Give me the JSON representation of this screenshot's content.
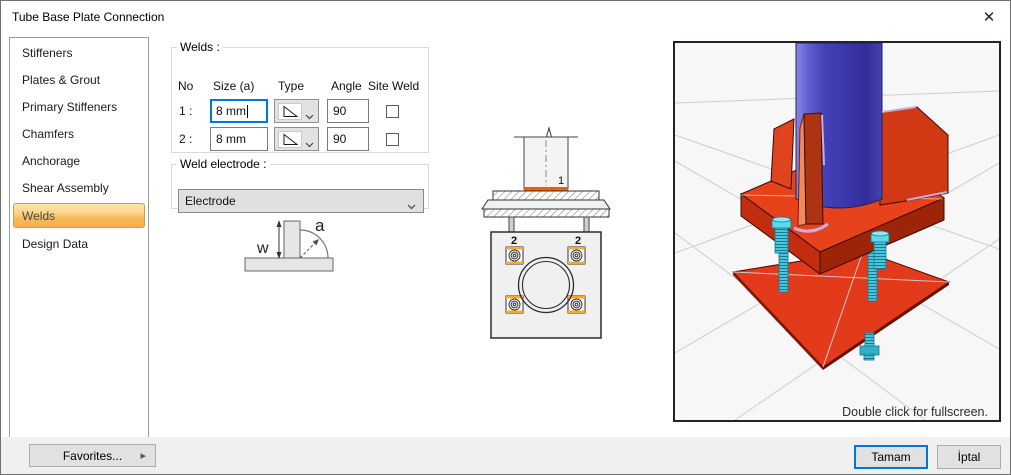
{
  "window": {
    "title": "Tube Base Plate Connection",
    "close_glyph": "✕"
  },
  "sidebar": {
    "items": [
      {
        "label": "Stiffeners",
        "selected": false
      },
      {
        "label": "Plates & Grout",
        "selected": false
      },
      {
        "label": "Primary Stiffeners",
        "selected": false
      },
      {
        "label": "Chamfers",
        "selected": false
      },
      {
        "label": "Anchorage",
        "selected": false
      },
      {
        "label": "Shear Assembly",
        "selected": false
      },
      {
        "label": "Welds",
        "selected": true
      },
      {
        "label": "Design Data",
        "selected": false
      }
    ]
  },
  "welds_group": {
    "title": "Welds :",
    "headers": [
      "No",
      "Size (a)",
      "Type",
      "Angle",
      "Site Weld"
    ],
    "rows": [
      {
        "no": "1 :",
        "size": "8 mm",
        "angle": "90",
        "site_weld_checked": false,
        "focused": true
      },
      {
        "no": "2 :",
        "size": "8 mm",
        "angle": "90",
        "site_weld_checked": false,
        "focused": false
      }
    ],
    "type_icon": "fillet-weld-triangle-icon"
  },
  "electrode_group": {
    "title": "Weld electrode :",
    "value": "Electrode"
  },
  "weld_symbol": {
    "w": "w",
    "a": "a"
  },
  "section_view": {
    "weld_number": "1"
  },
  "plan_view": {
    "bolt_labels": [
      "2",
      "2"
    ]
  },
  "preview": {
    "hint": "Double click for fullscreen."
  },
  "footer": {
    "favorites": "Favorites...",
    "arrow": "▸",
    "ok": "Tamam",
    "cancel": "İptal"
  },
  "colors": {
    "selection_orange_top": "#FDE5B0",
    "selection_orange_bottom": "#F5AE47",
    "selection_border": "#D49B4F",
    "weld_highlight_orange": "#E8600A",
    "focus_blue": "#0078D7",
    "tube_blue": "#433FB6",
    "plate_red": "#E0381A",
    "stiffener_light": "#EE8A5D",
    "bolt_cyan": "#4FC3D9",
    "plan_bolt_accent": "#FFA726"
  }
}
